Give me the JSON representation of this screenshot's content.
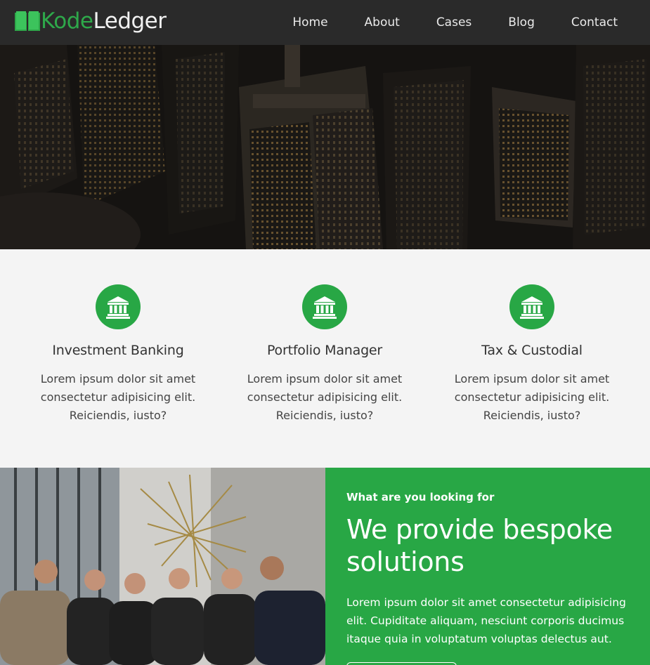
{
  "brand": {
    "part1": "Kode",
    "part2": "Ledger",
    "accent": "#28a745"
  },
  "nav": {
    "items": [
      {
        "label": "Home"
      },
      {
        "label": "About"
      },
      {
        "label": "Cases"
      },
      {
        "label": "Blog"
      },
      {
        "label": "Contact"
      }
    ]
  },
  "services": [
    {
      "title": "Investment Banking",
      "text": "Lorem ipsum dolor sit amet consectetur adipisicing elit. Reiciendis, iusto?",
      "icon": "bank-icon"
    },
    {
      "title": "Portfolio Manager",
      "text": "Lorem ipsum dolor sit amet consectetur adipisicing elit. Reiciendis, iusto?",
      "icon": "bank-icon"
    },
    {
      "title": "Tax & Custodial",
      "text": "Lorem ipsum dolor sit amet consectetur adipisicing elit. Reiciendis, iusto?",
      "icon": "bank-icon"
    }
  ],
  "promo": {
    "kicker": "What are you looking for",
    "heading": "We provide bespoke solutions",
    "text": "Lorem ipsum dolor sit amet consectetur adipisicing elit. Cupiditate aliquam, nesciunt corporis ducimus itaque quia in voluptatum voluptas delectus aut."
  }
}
